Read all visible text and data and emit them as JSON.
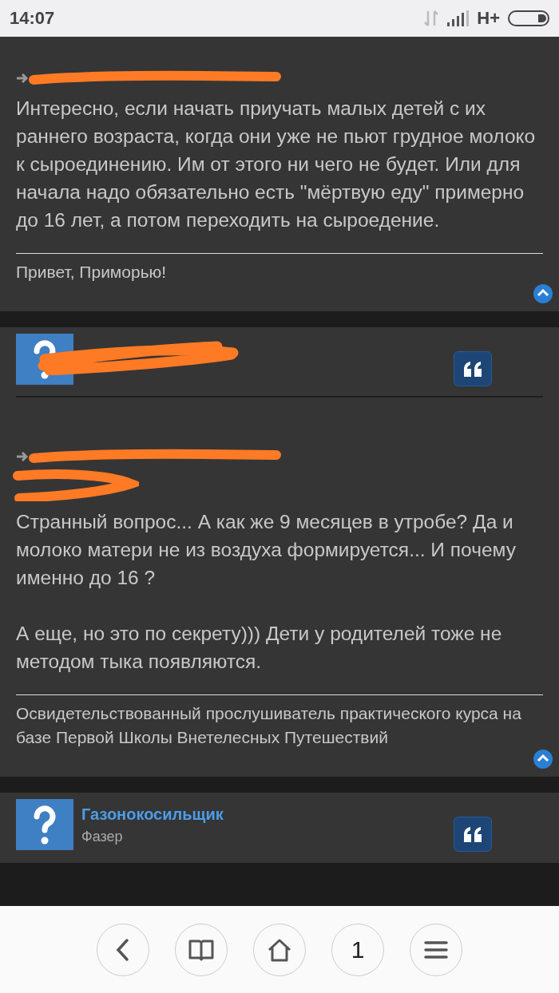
{
  "status_bar": {
    "time": "14:07",
    "network": "H+"
  },
  "posts": [
    {
      "date": {
        "redacted": true
      },
      "body": [
        "Интересно, если начать приучать малых детей с их раннего возраста, когда они уже не пьют грудное молоко к сыроединению. Им от этого ни чего не будет. Или для начала надо обязательно есть \"мёртвую еду\" примерно до 16 лет, а потом переходить на сыроедение."
      ],
      "signature": "Привет, Приморью!"
    },
    {
      "author": {
        "redacted": true
      },
      "date": {
        "redacted": true
      },
      "quote_author": {
        "redacted": true
      },
      "body": [
        "Странный вопрос... А как же 9 месяцев в утробе? Да и молоко матери не из воздуха формируется... И почему именно до 16 ?",
        "А еще, но это по секрету))) Дети у родителей тоже не методом тыка появляются."
      ],
      "signature": "Освидетельствованный прослушиватель практического курса на базе Первой Школы Внетелесных Путешествий"
    },
    {
      "author": {
        "redacted": false,
        "name": "Газонокосильщик",
        "rank": "Фазер"
      }
    }
  ],
  "bottom_nav": [
    {
      "kind": "back"
    },
    {
      "kind": "book"
    },
    {
      "kind": "home"
    },
    {
      "kind": "tabs",
      "label": "1"
    },
    {
      "kind": "menu"
    }
  ]
}
